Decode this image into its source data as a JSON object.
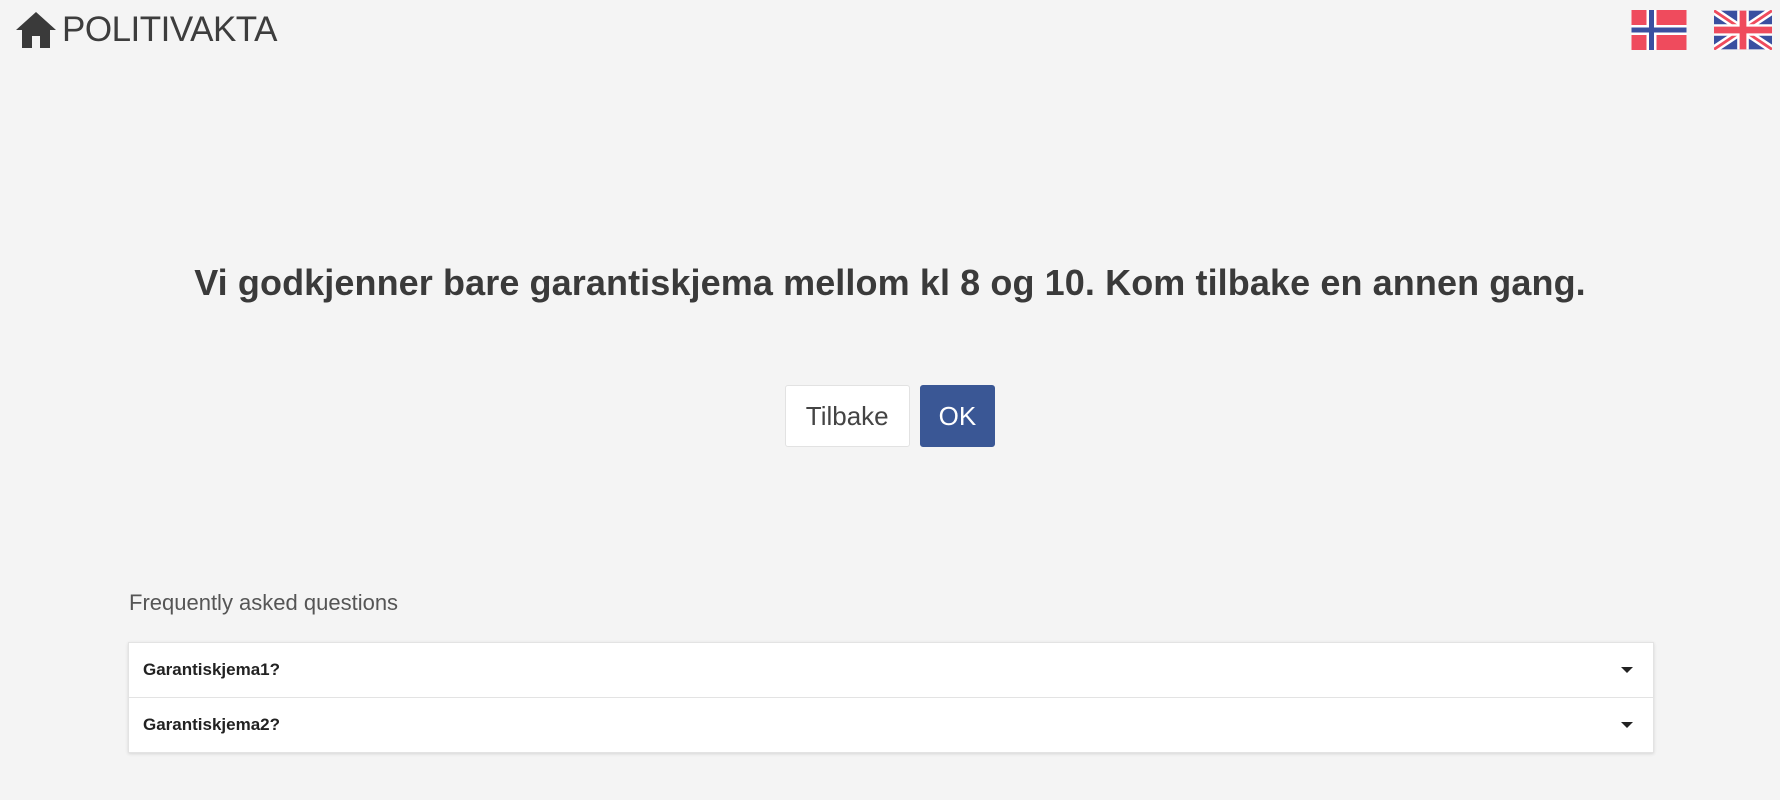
{
  "header": {
    "brand_label": "POLITIVAKTA",
    "home_icon": "home-icon",
    "languages": [
      {
        "code": "no",
        "icon": "norway-flag-icon"
      },
      {
        "code": "en",
        "icon": "uk-flag-icon"
      }
    ]
  },
  "main": {
    "message": "Vi godkjenner bare garantiskjema mellom kl 8 og 10. Kom tilbake en annen gang.",
    "back_label": "Tilbake",
    "ok_label": "OK"
  },
  "faq": {
    "title": "Frequently asked questions",
    "items": [
      {
        "question": "Garantiskjema1?"
      },
      {
        "question": "Garantiskjema2?"
      }
    ]
  },
  "colors": {
    "background": "#f4f4f4",
    "primary": "#3a5795",
    "norway_red": "#ef4b5d",
    "norway_blue": "#3a4fa0"
  }
}
